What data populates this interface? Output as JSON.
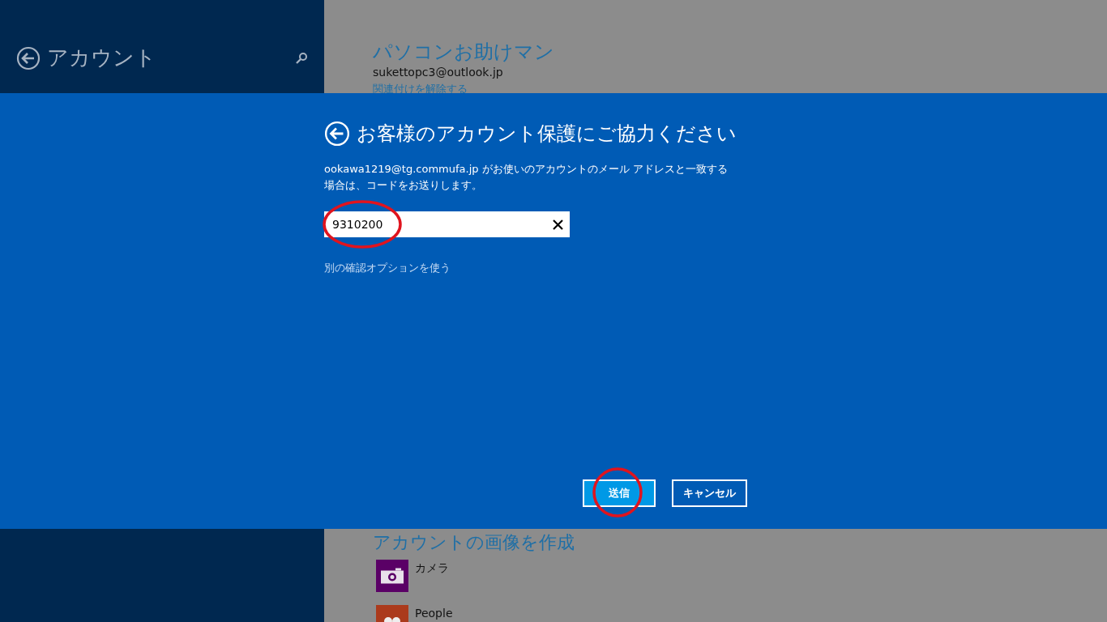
{
  "sidebar": {
    "title": "アカウント"
  },
  "account": {
    "name": "パソコンお助けマン",
    "email": "sukettopc3@outlook.jp",
    "unlink_link": "関連付けを解除する"
  },
  "picture_section": {
    "heading": "アカウントの画像を作成",
    "apps": [
      {
        "kind": "camera",
        "label": "カメラ",
        "color": "#5a0066"
      },
      {
        "kind": "people",
        "label": "People",
        "color": "#ab3a1c"
      }
    ]
  },
  "dialog": {
    "title": "お客様のアカウント保護にご協力ください",
    "message": "ookawa1219@tg.commufa.jp がお使いのアカウントのメール アドレスと一致する場合は、コードをお送りします。",
    "code_field": {
      "value": "9310200",
      "circled": true
    },
    "other_option_link": "別の確認オプションを使う",
    "buttons": [
      {
        "label": "送信",
        "primary": true,
        "circled": true
      },
      {
        "label": "キャンセル",
        "primary": false,
        "circled": false
      }
    ]
  }
}
